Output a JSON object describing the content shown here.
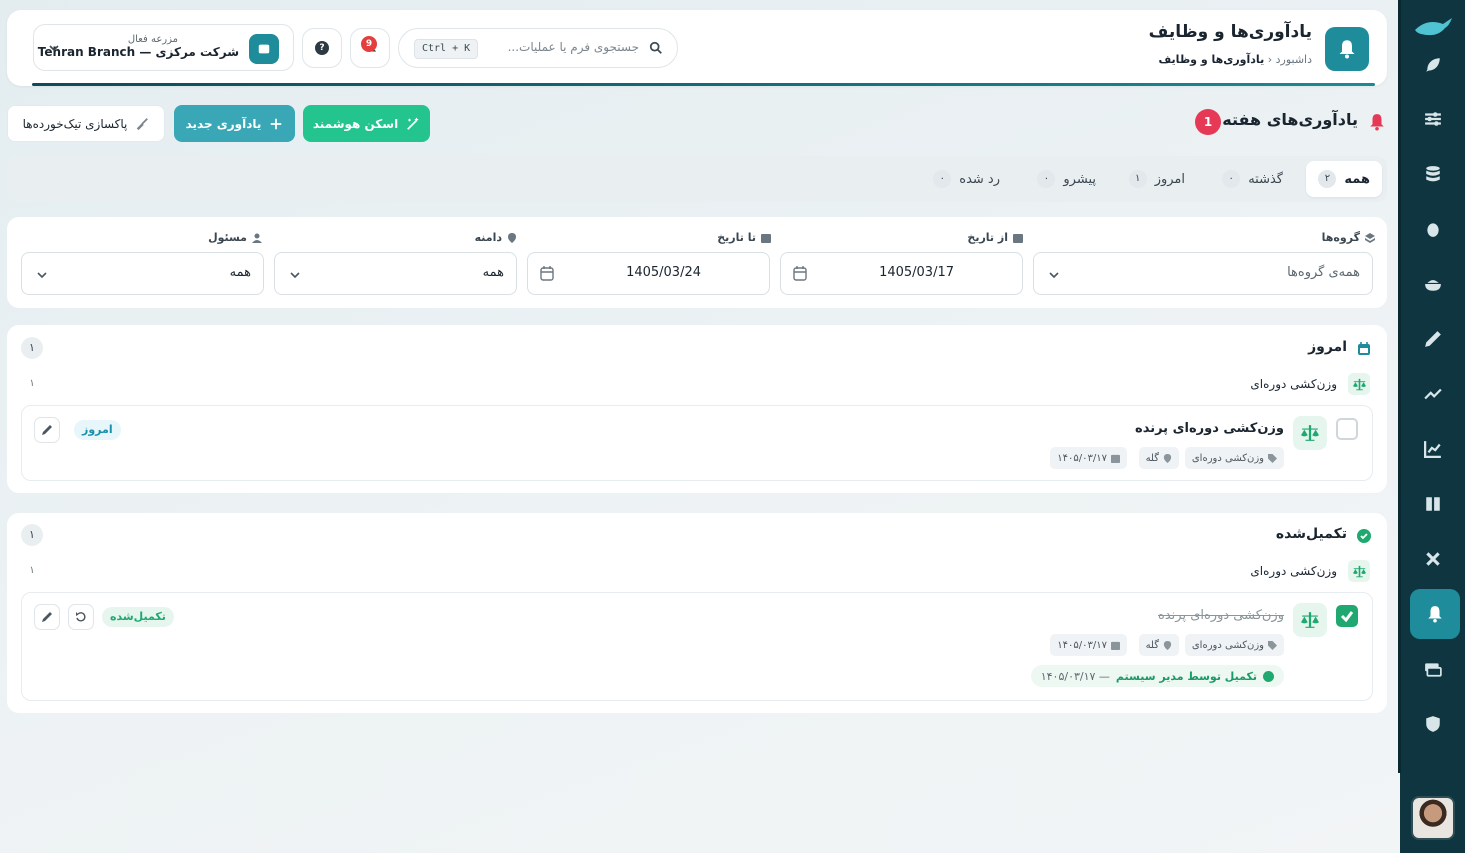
{
  "header": {
    "title": "یادآوری‌ها و وظایف",
    "breadcrumb": {
      "home": "داشبورد",
      "current": "یادآوری‌ها و وظایف"
    },
    "search": {
      "placeholder": "جستجوی فرم یا عملیات...",
      "shortcut": "Ctrl + K"
    },
    "notifications_count": "9",
    "help_label": "?",
    "farm": {
      "label": "مزرعه فعال",
      "name": "شرکت مرکزی — Tehran Branch"
    }
  },
  "toolbar": {
    "week_title": "یادآوری‌های هفته",
    "week_count": "1",
    "scan_label": "اسکن هوشمند",
    "new_label": "یادآوری جدید",
    "clean_label": "پاکسازی تیک‌خورده‌ها"
  },
  "tabs": [
    {
      "label": "همه",
      "count": "۲"
    },
    {
      "label": "گذشته",
      "count": "۰"
    },
    {
      "label": "امروز",
      "count": "۱"
    },
    {
      "label": "پیشرو",
      "count": "۰"
    },
    {
      "label": "رد شده",
      "count": "۰"
    }
  ],
  "filters": {
    "groups": {
      "label": "گروه‌ها",
      "value": "همه‌ی گروه‌ها"
    },
    "from_date": {
      "label": "از تاریخ",
      "value": "1405/03/17"
    },
    "to_date": {
      "label": "تا تاریخ",
      "value": "1405/03/24"
    },
    "domain": {
      "label": "دامنه",
      "value": "همه"
    },
    "owner": {
      "label": "مسئول",
      "value": "همه"
    }
  },
  "sections": [
    {
      "title": "امروز",
      "count": "۱",
      "group": {
        "title": "وزن‌کشی دوره‌ای",
        "count": "۱"
      },
      "item": {
        "name": "وزن‌کشی دوره‌ای پرنده",
        "category": "وزن‌کشی دوره‌ای",
        "location": "گله",
        "date": "۱۴۰۵/۰۳/۱۷",
        "tag": "امروز"
      }
    },
    {
      "title": "تکمیل‌شده",
      "count": "۱",
      "group": {
        "title": "وزن‌کشی دوره‌ای",
        "count": "۱"
      },
      "item": {
        "name": "وزن‌کشی دوره‌ای پرنده",
        "category": "وزن‌کشی دوره‌ای",
        "location": "گله",
        "date": "۱۴۰۵/۰۳/۱۷",
        "tag": "تکمیل‌شده",
        "completed_by": "تکمیل توسط مدیر سیستم",
        "completed_at": "— ۱۴۰۵/۰۳/۱۷"
      }
    }
  ],
  "colors": {
    "accent": "#1e8c9a",
    "success": "#1fa870",
    "danger": "#e53955",
    "sidebar": "#0f3540"
  },
  "sidebar_icons": [
    "logo-icon",
    "feather-icon",
    "sliders-icon",
    "database-icon",
    "egg-icon",
    "bowl-icon",
    "pen-icon",
    "trend-icon",
    "chart-icon",
    "book-icon",
    "tools-icon",
    "bell-icon",
    "money-icon",
    "shield-icon"
  ]
}
